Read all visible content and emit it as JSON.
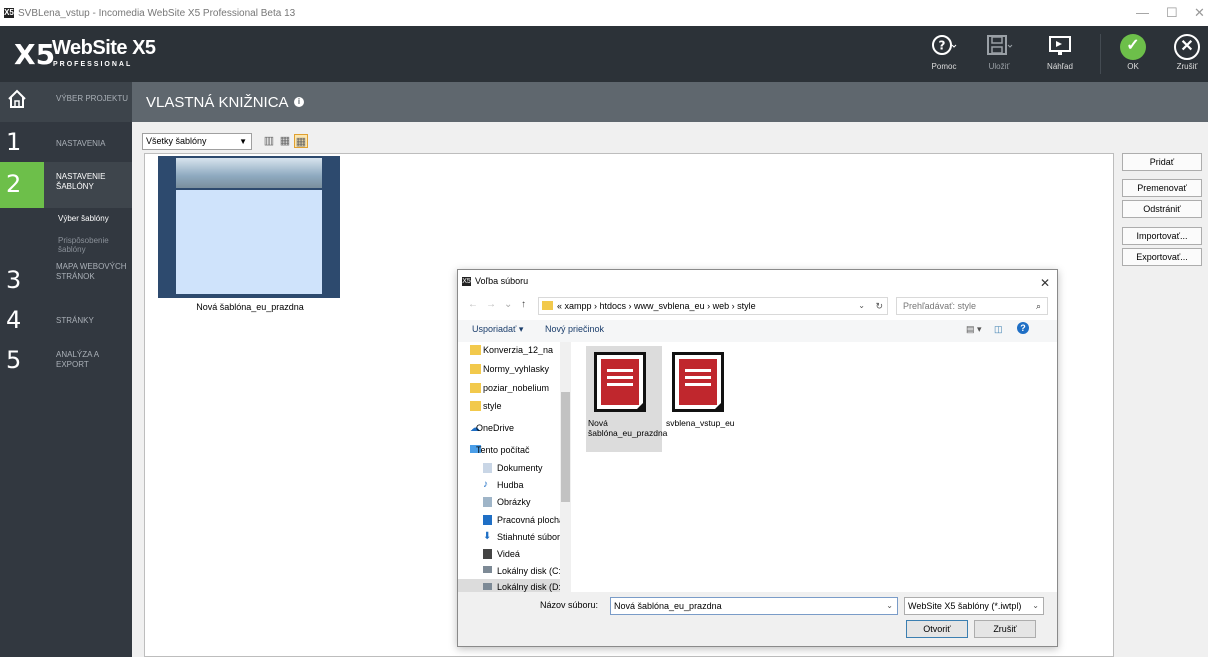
{
  "window": {
    "title": "SVBLena_vstup - Incomedia WebSite X5 Professional Beta 13",
    "app_icon": "X5",
    "controls": {
      "minimize": "—",
      "maximize": "☐",
      "close": "✕"
    }
  },
  "header": {
    "logo_mark": "X5",
    "logo_name": "WebSite X5",
    "logo_sub": "PROFESSIONAL",
    "buttons": {
      "help": {
        "label": "Pomoc",
        "icon": "help-icon"
      },
      "save": {
        "label": "Uložiť",
        "icon": "save-icon"
      },
      "preview": {
        "label": "Náhľad",
        "icon": "preview-icon"
      },
      "ok": {
        "label": "OK",
        "icon": "check-icon"
      },
      "cancel": {
        "label": "Zrušiť",
        "icon": "close-icon"
      }
    },
    "colors": {
      "background": "#2c3238",
      "ok": "#6dbf4a"
    }
  },
  "sidebar": {
    "home_label": "VÝBER PROJEKTU",
    "steps": [
      {
        "num": "1",
        "label": "NASTAVENIA"
      },
      {
        "num": "2",
        "label": "NASTAVENIE ŠABLÓNY",
        "subs": [
          "Výber šablóny",
          "Prispôsobenie šablóny"
        ]
      },
      {
        "num": "3",
        "label": "MAPA WEBOVÝCH STRÁNOK"
      },
      {
        "num": "4",
        "label": "STRÁNKY"
      },
      {
        "num": "5",
        "label": "ANALÝZA A EXPORT"
      }
    ],
    "active_color": "#6dbf4a"
  },
  "main": {
    "title": "VLASTNÁ KNIŽNICA",
    "filter_value": "Všetky šablóny",
    "template_name": "Nová šablóna_eu_prazdna",
    "actions": [
      "Pridať",
      "Premenovať",
      "Odstrániť",
      "Importovať...",
      "Exportovať..."
    ]
  },
  "dialog": {
    "title": "Voľba súboru",
    "breadcrumb": "« xampp › htdocs › www_svblena_eu › web › style",
    "search_placeholder": "Prehľadávať: style",
    "organize": "Usporiadať ▾",
    "new_folder": "Nový priečinok",
    "nav_items": [
      {
        "label": "Konverzia_12_na",
        "icon": "folder-icon"
      },
      {
        "label": "Normy_vyhlasky",
        "icon": "folder-icon"
      },
      {
        "label": "poziar_nobelium",
        "icon": "folder-icon"
      },
      {
        "label": "style",
        "icon": "folder-icon"
      },
      {
        "label": "OneDrive",
        "icon": "cloud-icon"
      },
      {
        "label": "Tento počítač",
        "icon": "computer-icon"
      },
      {
        "label": "Dokumenty",
        "icon": "documents-icon"
      },
      {
        "label": "Hudba",
        "icon": "music-icon"
      },
      {
        "label": "Obrázky",
        "icon": "pictures-icon"
      },
      {
        "label": "Pracovná plocha",
        "icon": "desktop-icon"
      },
      {
        "label": "Stiahnuté súbory",
        "icon": "download-icon"
      },
      {
        "label": "Videá",
        "icon": "video-icon"
      },
      {
        "label": "Lokálny disk (C:)",
        "icon": "drive-icon"
      },
      {
        "label": "Lokálny disk (D:)",
        "icon": "drive-icon"
      }
    ],
    "files": [
      {
        "name": "Nová šablóna_eu_prazdna"
      },
      {
        "name": "svblena_vstup_eu"
      }
    ],
    "filename_label": "Názov súboru:",
    "filename_value": "Nová šablóna_eu_prazdna",
    "filetype": "WebSite X5 šablóny (*.iwtpl)",
    "open": "Otvoriť",
    "cancel": "Zrušiť"
  }
}
